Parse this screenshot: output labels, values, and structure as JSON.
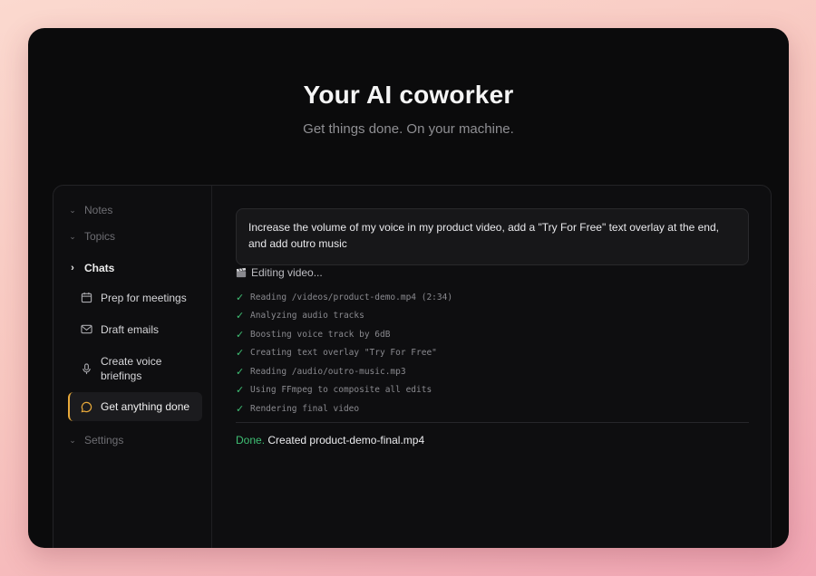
{
  "hero": {
    "title": "Your AI coworker",
    "subtitle": "Get things done. On your machine."
  },
  "sidebar": {
    "items": [
      {
        "label": "Notes",
        "icon": "chevron-down-icon"
      },
      {
        "label": "Topics",
        "icon": "chevron-down-icon"
      },
      {
        "label": "Chats",
        "icon": "chevron-right-icon"
      },
      {
        "label": "Settings",
        "icon": "chevron-down-icon"
      }
    ],
    "chats": [
      {
        "label": "Prep for meetings",
        "icon": "calendar-icon"
      },
      {
        "label": "Draft emails",
        "icon": "mail-icon"
      },
      {
        "label": "Create voice briefings",
        "icon": "microphone-icon"
      },
      {
        "label": "Get anything done",
        "icon": "chat-bubble-icon"
      }
    ]
  },
  "chat": {
    "prompt": "Increase the volume of my voice in my product video, add a \"Try For Free\" text overlay at the end, and add outro music",
    "status": "Editing video...",
    "status_icon": "clapperboard-icon",
    "steps": [
      "Reading /videos/product-demo.mp4 (2:34)",
      "Analyzing audio tracks",
      "Boosting voice track by 6dB",
      "Creating text overlay \"Try For Free\"",
      "Reading /audio/outro-music.mp3",
      "Using FFmpeg to composite all edits",
      "Rendering final video"
    ],
    "done_label": "Done.",
    "done_text": "Created product-demo-final.mp4"
  },
  "colors": {
    "accent": "#e8a93a",
    "success": "#3fbf74"
  }
}
